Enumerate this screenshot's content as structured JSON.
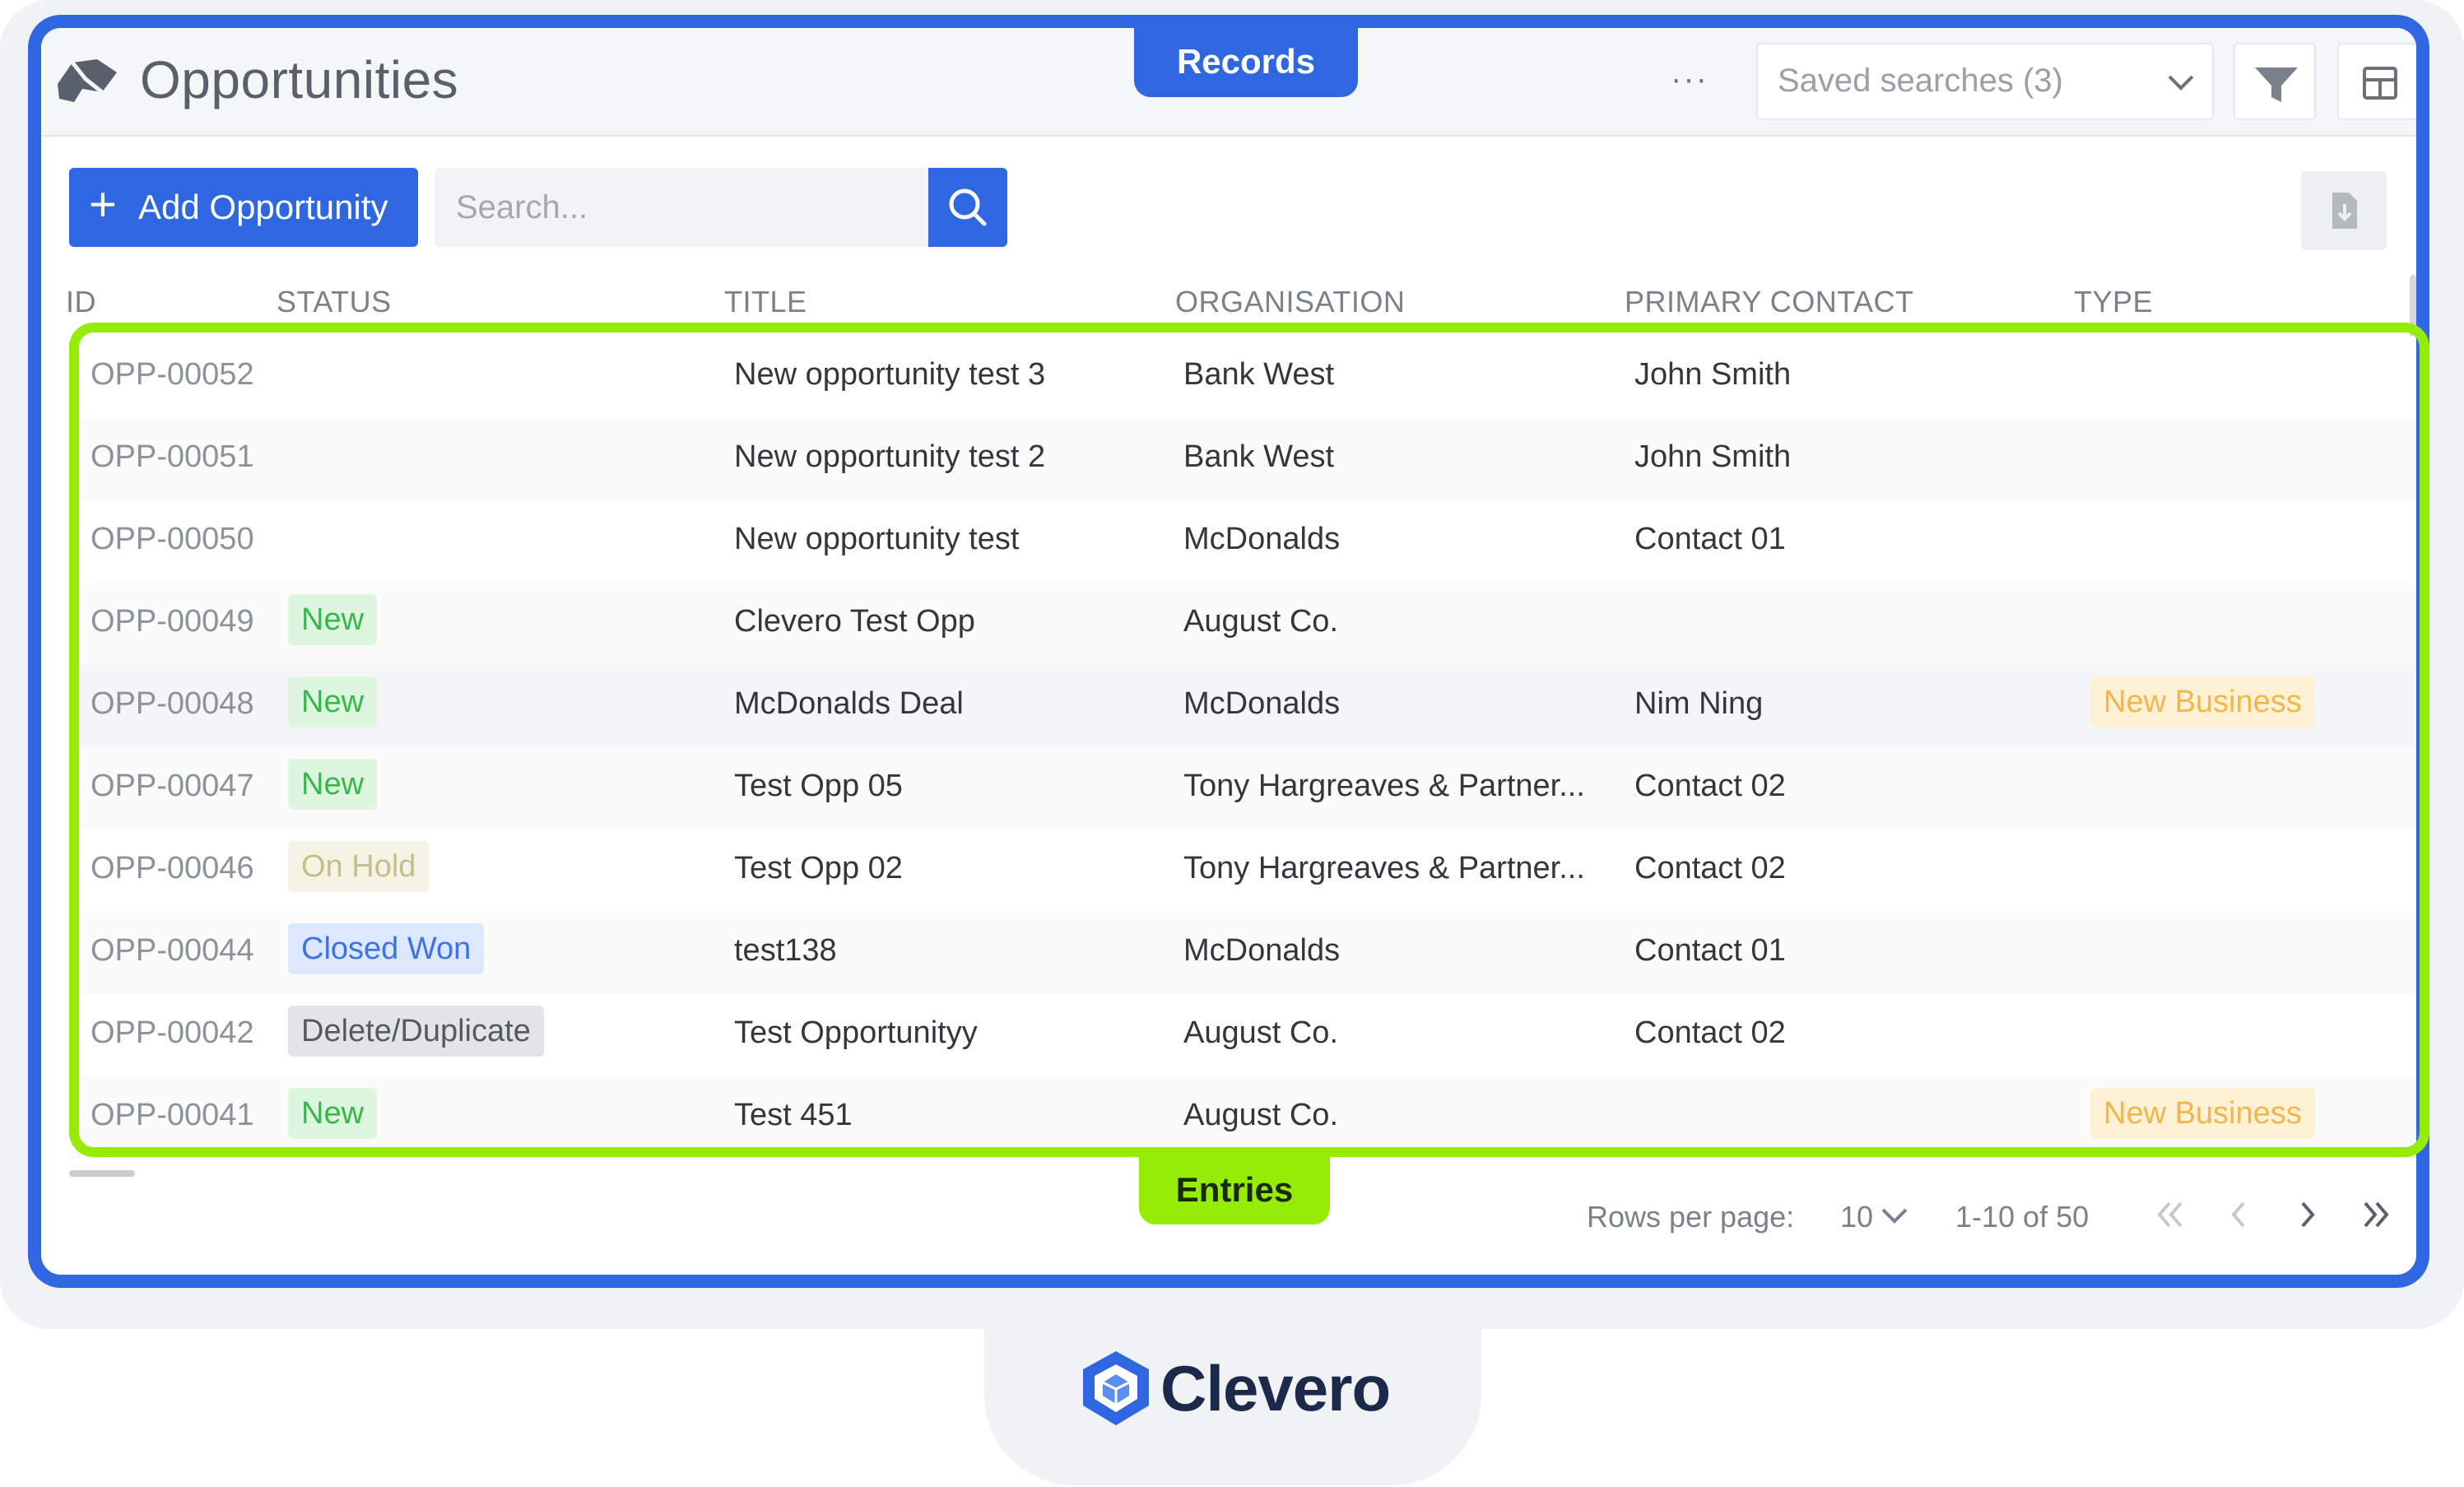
{
  "header": {
    "title": "Opportunities",
    "more": "···",
    "saved_searches": "Saved searches (3)"
  },
  "overlay_pills": {
    "records": "Records",
    "entries": "Entries"
  },
  "toolbar": {
    "add_label": "Add Opportunity",
    "add_icon": "plus-icon",
    "search_placeholder": "Search...",
    "search_icon": "search-icon",
    "export_icon": "download-file-icon"
  },
  "table": {
    "columns": [
      "ID",
      "STATUS",
      "TITLE",
      "ORGANISATION",
      "PRIMARY CONTACT",
      "TYPE"
    ],
    "rows": [
      {
        "id": "OPP-00052",
        "status": "",
        "status_kind": "",
        "title": "New opportunity test 3",
        "org": "Bank West",
        "contact": "John Smith",
        "type": ""
      },
      {
        "id": "OPP-00051",
        "status": "",
        "status_kind": "",
        "title": "New opportunity test 2",
        "org": "Bank West",
        "contact": "John Smith",
        "type": ""
      },
      {
        "id": "OPP-00050",
        "status": "",
        "status_kind": "",
        "title": "New opportunity test",
        "org": "McDonalds",
        "contact": "Contact 01",
        "type": ""
      },
      {
        "id": "OPP-00049",
        "status": "New",
        "status_kind": "new",
        "title": "Clevero Test Opp",
        "org": "August Co.",
        "contact": "",
        "type": ""
      },
      {
        "id": "OPP-00048",
        "status": "New",
        "status_kind": "new",
        "title": "McDonalds Deal",
        "org": "McDonalds",
        "contact": "Nim Ning",
        "type": "New Business"
      },
      {
        "id": "OPP-00047",
        "status": "New",
        "status_kind": "new",
        "title": "Test Opp 05",
        "org": "Tony Hargreaves & Partner...",
        "contact": "Contact 02",
        "type": ""
      },
      {
        "id": "OPP-00046",
        "status": "On Hold",
        "status_kind": "hold",
        "title": "Test Opp 02",
        "org": "Tony Hargreaves & Partner...",
        "contact": "Contact 02",
        "type": ""
      },
      {
        "id": "OPP-00044",
        "status": "Closed Won",
        "status_kind": "won",
        "title": "test138",
        "org": "McDonalds",
        "contact": "Contact 01",
        "type": ""
      },
      {
        "id": "OPP-00042",
        "status": "Delete/Duplicate",
        "status_kind": "dup",
        "title": "Test Opportunityy",
        "org": "August Co.",
        "contact": "Contact 02",
        "type": ""
      },
      {
        "id": "OPP-00041",
        "status": "New",
        "status_kind": "new",
        "title": "Test 451",
        "org": "August Co.",
        "contact": "",
        "type": "New Business"
      }
    ]
  },
  "pagination": {
    "rows_per_page_label": "Rows per page:",
    "rows_per_page": "10",
    "range": "1-10 of 50"
  },
  "brand": {
    "name": "Clevero"
  },
  "colors": {
    "accent": "#2f67e0",
    "highlight": "#96ec06"
  }
}
